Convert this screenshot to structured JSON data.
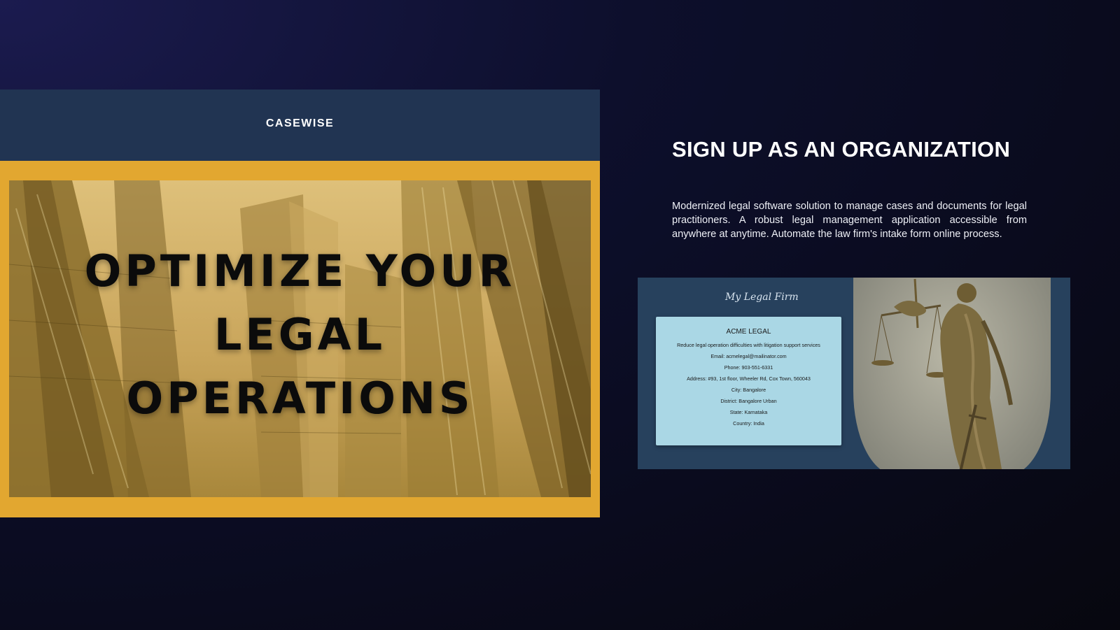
{
  "brand": {
    "name": "CASEWISE"
  },
  "hero": {
    "headline_lines": [
      "OPTIMIZE YOUR",
      "LEGAL",
      "OPERATIONS"
    ]
  },
  "signup": {
    "title": "SIGN UP AS AN ORGANIZATION",
    "description": "Modernized legal software solution to manage cases and documents for legal practitioners. A robust legal management application accessible from anywhere at anytime. Automate the law firm's intake form online process."
  },
  "preview": {
    "firm_name": "My Legal Firm",
    "card": {
      "title": "ACME LEGAL",
      "tagline": "Reduce legal operation difficulties with litigation support services",
      "email": "Email: acmelegal@mailinator.com",
      "phone": "Phone: 903-551-6331",
      "address": "Address: #93, 1st floor, Wheeler Rd, Cox Town, 560043",
      "city": "City: Bangalore",
      "district": "District: Bangalore Urban",
      "state": "State: Karnataka",
      "country": "Country: India"
    }
  },
  "colors": {
    "header_bg": "#213452",
    "hero_frame": "#e2a730",
    "preview_bg": "#27415d",
    "card_bg": "#aad7e5"
  },
  "icons": [
    "city-skyline-image",
    "lady-justice-image"
  ]
}
